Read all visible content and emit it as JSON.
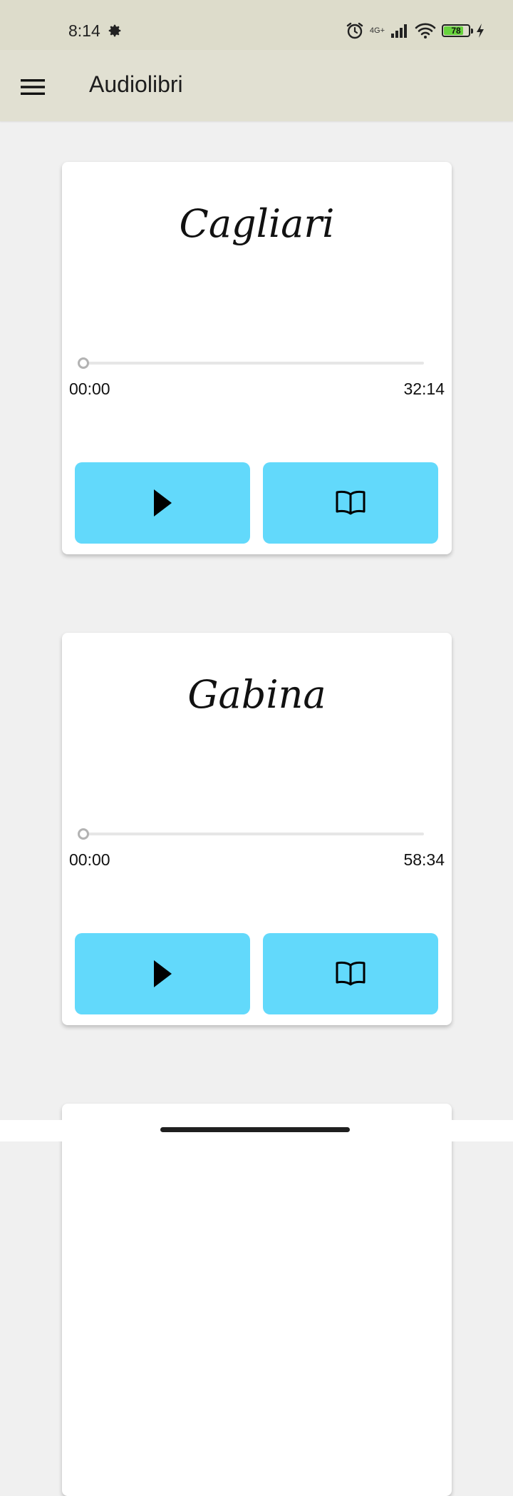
{
  "status_bar": {
    "time": "8:14",
    "network": "4G+",
    "battery_level": "78",
    "battery_fill_fraction": 0.78,
    "icons": [
      "gear-icon",
      "alarm-icon",
      "signal-icon",
      "wifi-icon",
      "battery-icon",
      "charging-icon"
    ]
  },
  "app_bar": {
    "title": "Audiolibri",
    "menu_icon": "hamburger-menu-icon"
  },
  "audiobooks": [
    {
      "title": "Cagliari",
      "current_time": "00:00",
      "duration": "32:14",
      "progress": 0,
      "play_icon": "play-icon",
      "read_icon": "book-icon"
    },
    {
      "title": "Gabina",
      "current_time": "00:00",
      "duration": "58:34",
      "progress": 0,
      "play_icon": "play-icon",
      "read_icon": "book-icon"
    }
  ],
  "colors": {
    "status_bar_bg": "#dddccb",
    "app_bar_bg": "#e1e0d2",
    "page_bg": "#f0f0f0",
    "button_accent": "#62d9fb",
    "battery_green": "#67d23d"
  }
}
